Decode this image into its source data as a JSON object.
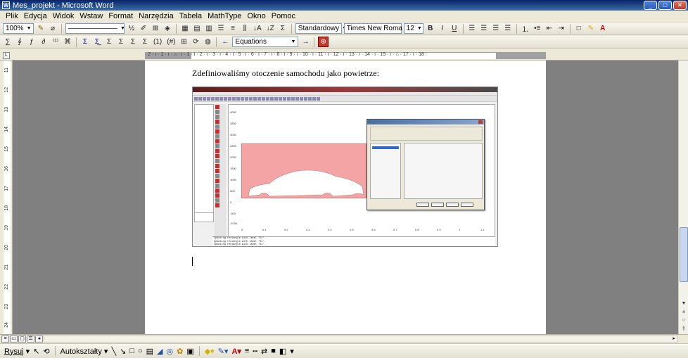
{
  "window": {
    "title": "Mes_projekt - Microsoft Word",
    "app_icon": "W",
    "min": "_",
    "max": "□",
    "close": "✕"
  },
  "menu": [
    "Plik",
    "Edycja",
    "Widok",
    "Wstaw",
    "Format",
    "Narzędzia",
    "Tabela",
    "MathType",
    "Okno",
    "Pomoc"
  ],
  "toolbar1": {
    "zoom": "100%",
    "style": "Standardowy",
    "font": "Times New Roman",
    "font_display": "Times New Roma",
    "size": "12",
    "bold": "B",
    "italic": "I",
    "underline": "U",
    "fraction_label": "½"
  },
  "toolbar2": {
    "equations": "Equations",
    "sigma": "Σ"
  },
  "ruler": {
    "corner": "L",
    "numbers": "· 2 · ı · 1 · ı · ⌂ · ı · 1 · ı · 2 · ı · 3 · ı · 4 · ı · 5 · ı · 6 · ı · 7 · ı · 8 · ı · 9 · ı · 10 · ı · 11 · ı · 12 · ı · 13 · ı · 14 · ı · 15 · ı · ⌂ · 17 · ı · 18 ·"
  },
  "vertical_ruler": [
    "11",
    "12",
    "13",
    "14",
    "15",
    "16",
    "17",
    "18",
    "19",
    "20",
    "21",
    "22",
    "23",
    "24"
  ],
  "document": {
    "paragraph": "Zdefiniowaliśmy otoczenie samochodu jako powietrze:"
  },
  "embedded_screenshot": {
    "description": "COMSOL Multiphysics window showing a subdomain settings dialog over a geometry with a car silhouette inside a rectangle",
    "x_ticks": [
      "0",
      "0.1",
      "0.2",
      "0.3",
      "0.4",
      "0.5",
      "0.6",
      "0.7",
      "0.8",
      "0.9",
      "1",
      "1.1"
    ],
    "y_ticks": [
      "4000",
      "3500",
      "3000",
      "2500",
      "2000",
      "1500",
      "1000",
      "500",
      "0",
      "-500",
      "-1000"
    ],
    "log": [
      "Updating rectangle with label 'R1'.",
      "Updating rectangle with label 'R1'.",
      "Updating rectangle with label 'R1'."
    ],
    "dialog_title": "Subdomain Settings - Incompressible Navier-Stokes (ns)"
  },
  "drawing_toolbar": {
    "draw": "Rysuj",
    "autoshapes": "Autokształty"
  },
  "colors": {
    "titlebar": "#0a246a",
    "car_region": "#f4a4a4",
    "accent_red": "#c0392b"
  }
}
